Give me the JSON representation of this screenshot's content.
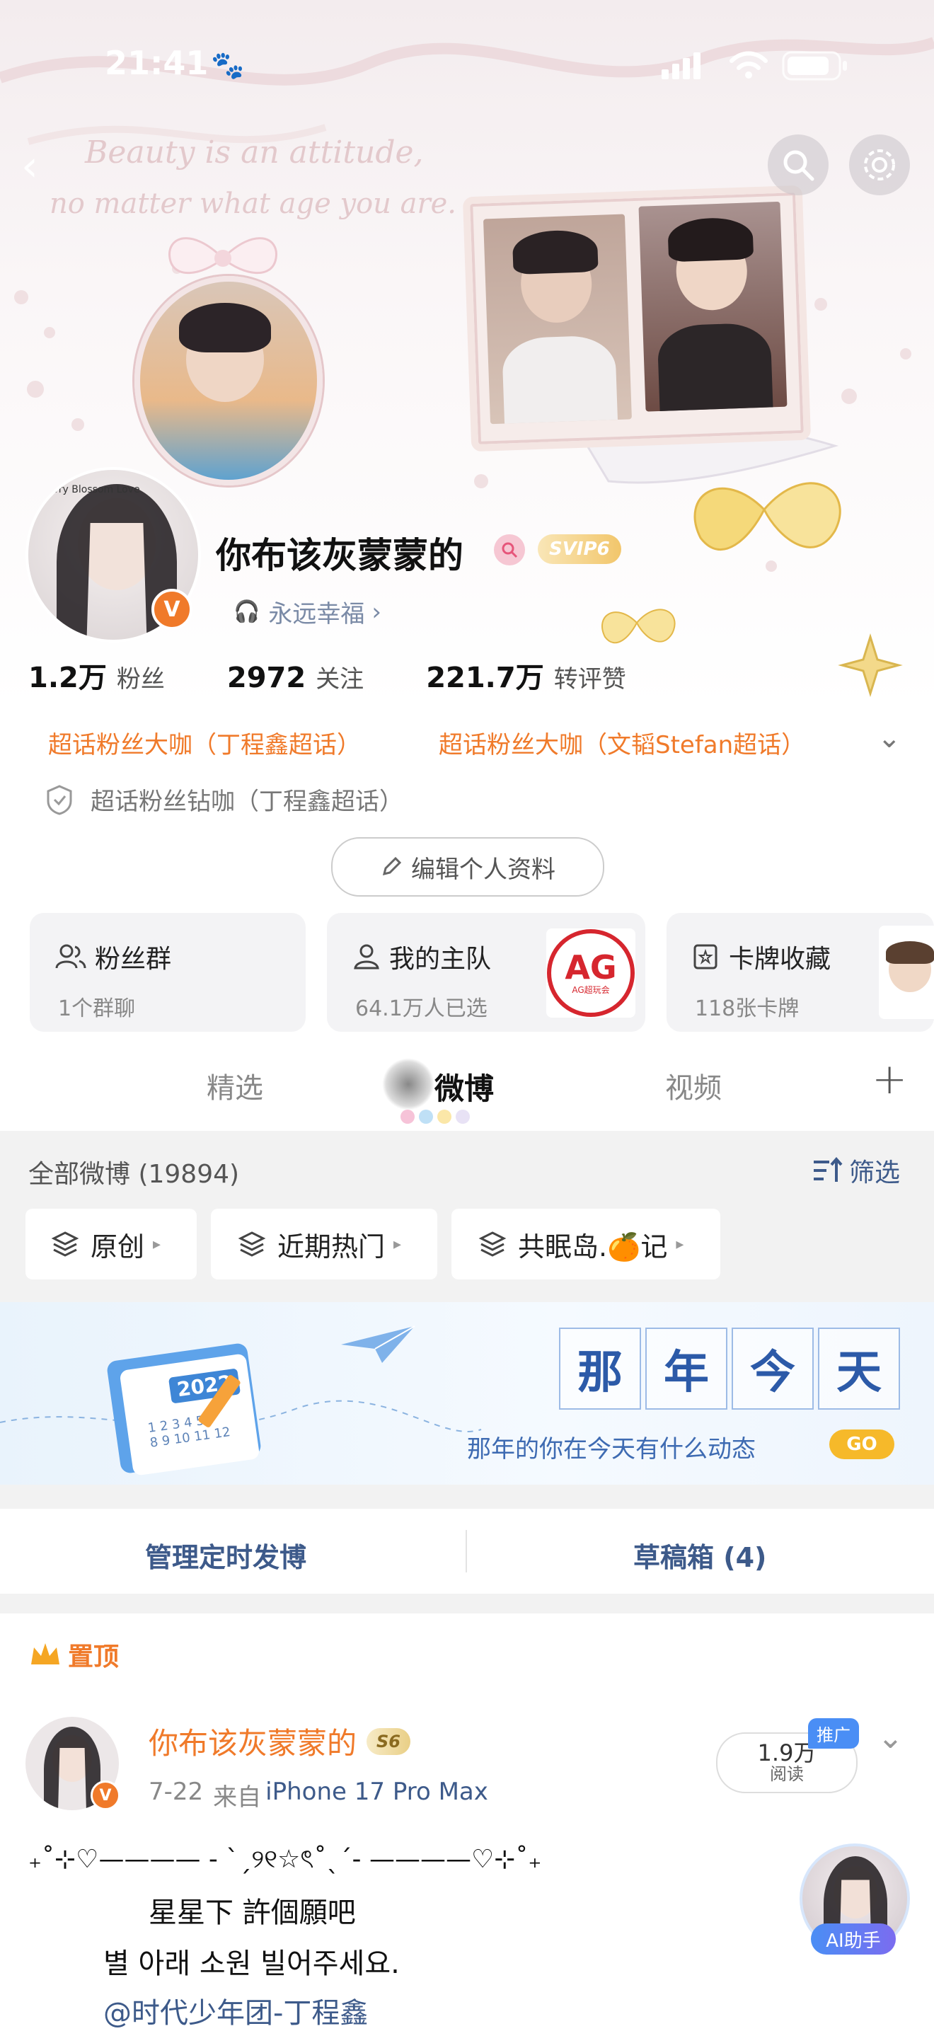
{
  "status_bar": {
    "time": "21:41"
  },
  "header_bg": {
    "line1": "Beauty is an attitude,",
    "line2": "no matter what age you are."
  },
  "profile": {
    "name": "你布该灰蒙蒙的",
    "vip_badge": "SVIP6",
    "bio": "永远幸福",
    "followers_num": "1.2万",
    "followers_label": "粉丝",
    "following_num": "2972",
    "following_label": "关注",
    "likes_num": "221.7万",
    "likes_label": "转评赞",
    "tag1": "超话粉丝大咖（丁程鑫超话）",
    "tag2": "超话粉丝大咖（文韬Stefan超话）",
    "tag3": "超话粉丝钻咖（丁程鑫超话）",
    "edit_label": "编辑个人资料",
    "avatar_caption": "Cherry Blossom Love"
  },
  "cards": [
    {
      "title": "粉丝群",
      "sub": "1个群聊"
    },
    {
      "title": "我的主队",
      "sub": "64.1万人已选",
      "logo": "AG超玩会"
    },
    {
      "title": "卡牌收藏",
      "sub": "118张卡牌"
    }
  ],
  "tabs": {
    "t1": "精选",
    "t2": "微博",
    "t3": "视频"
  },
  "feed": {
    "count_label": "全部微博 (19894)",
    "filter_label": "筛选",
    "f1": "原创",
    "f2": "近期热门",
    "f3": "共眠岛.🍊记"
  },
  "banner": {
    "year": "2022",
    "chars": [
      "那",
      "年",
      "今",
      "天"
    ],
    "subtitle": "那年的你在今天有什么动态",
    "go": "GO"
  },
  "manage": {
    "left": "管理定时发博",
    "right": "草稿箱 (4)"
  },
  "pinned": {
    "label": "置顶"
  },
  "post": {
    "name": "你布该灰蒙蒙的",
    "level_badge": "S6",
    "date": "7-22",
    "from_label": "来自",
    "device": "iPhone 17 Pro Max",
    "reads": "1.9万",
    "reads_label": "阅读",
    "promo": "推广",
    "line1": "₊˚⊹♡———— - ˋˏ୨୧☆ৎ˚ˎˊ- ————♡⊹˚₊",
    "line2": "星星下 許個願吧",
    "line3": "별 아래 소원 빌어주세요.",
    "mention": "@时代少年团-丁程鑫"
  },
  "ai": {
    "label": "AI助手"
  },
  "colors": {
    "orange": "#f07a2a",
    "blue_link": "#3d5a8a",
    "promo_blue": "#4a8ef5"
  }
}
